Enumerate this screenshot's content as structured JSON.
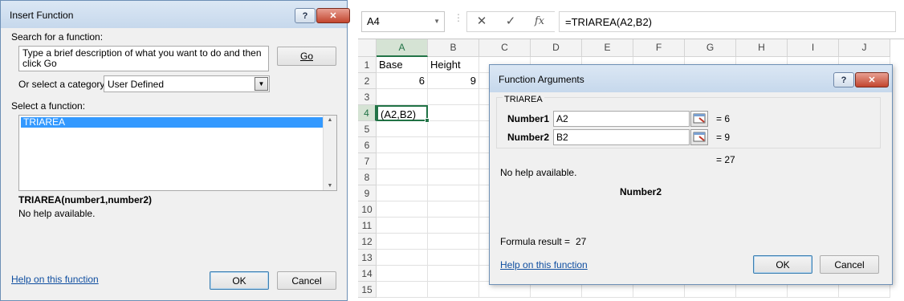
{
  "insert_function": {
    "title": "Insert Function",
    "help_button": "?",
    "close_button": "✕",
    "search_label": "Search for a function:",
    "search_value": "Type a brief description of what you want to do and then click Go",
    "go_button": "Go",
    "category_label": "Or select a category:",
    "category_value": "User Defined",
    "select_label": "Select a function:",
    "functions": [
      "TRIAREA"
    ],
    "signature": "TRIAREA(number1,number2)",
    "help_text": "No help available.",
    "help_link": "Help on this function",
    "ok_button": "OK",
    "cancel_button": "Cancel"
  },
  "excel": {
    "name_box": "A4",
    "formula": "=TRIAREA(A2,B2)",
    "icons": [
      "cancel-icon",
      "enter-icon",
      "fx-icon"
    ],
    "columns": [
      "A",
      "B",
      "C",
      "D",
      "E",
      "F",
      "G",
      "H",
      "I",
      "J"
    ],
    "rows": [
      "1",
      "2",
      "3",
      "4",
      "5",
      "6",
      "7",
      "8",
      "9",
      "10",
      "11",
      "12",
      "13",
      "14",
      "15"
    ],
    "cells": {
      "A1": "Base",
      "B1": "Height",
      "A2": "6",
      "B2": "9",
      "A4": "(A2,B2)"
    },
    "active_color": "#217346"
  },
  "function_arguments": {
    "title": "Function Arguments",
    "help_button": "?",
    "close_button": "✕",
    "function_name": "TRIAREA",
    "args": [
      {
        "label": "Number1",
        "value": "A2",
        "result": "6"
      },
      {
        "label": "Number2",
        "value": "B2",
        "result": "9"
      }
    ],
    "total_result": "27",
    "help_text": "No help available.",
    "arg_description_title": "Number2",
    "formula_result_label": "Formula result =",
    "formula_result_value": "27",
    "help_link": "Help on this function",
    "ok_button": "OK",
    "cancel_button": "Cancel"
  }
}
